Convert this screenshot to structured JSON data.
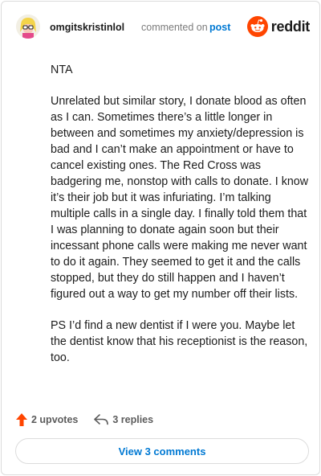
{
  "header": {
    "username": "omgitskristinlol",
    "action_text": "commented on",
    "post_link": "post",
    "logo_text": "reddit"
  },
  "comment": {
    "paragraphs": [
      "NTA",
      "Unrelated but similar story, I donate blood as often as I can. Sometimes there’s a little longer in between and sometimes my anxiety/depression is bad and I can’t make an appointment or have to cancel existing ones. The Red Cross was badgering me, nonstop with calls to donate. I know it’s their job but it was infuriating. I’m talking multiple calls in a single day. I finally told them that I was planning to donate again soon but their incessant phone calls were making me never want to do it again. They seemed to get it and the calls stopped, but they do still happen and I haven’t figured out a way to get my number off their lists.",
      "PS I’d find a new dentist if I were you. Maybe let the dentist know that his receptionist is the reason, too."
    ]
  },
  "actions": {
    "upvotes": "2 upvotes",
    "replies": "3 replies"
  },
  "view_comments": "View 3 comments",
  "colors": {
    "brand": "#ff4500",
    "link": "#0079d3",
    "muted": "#7c7c7c"
  },
  "icons": [
    "avatar",
    "reddit-logo-icon",
    "upvote-arrow-icon",
    "reply-icon"
  ]
}
